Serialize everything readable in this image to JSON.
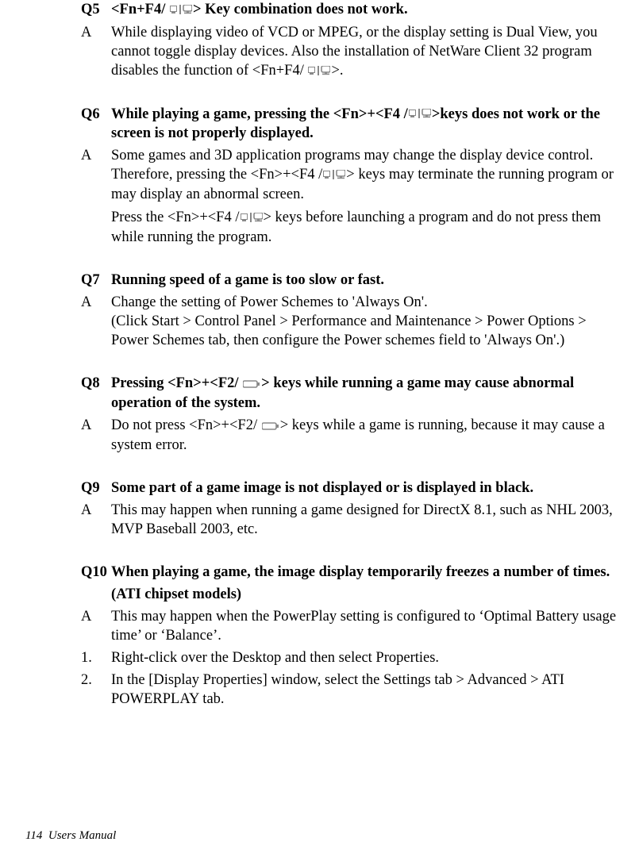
{
  "q5": {
    "label": "Q5",
    "question_a": "<Fn+F4/ ",
    "question_b": "> Key combination does not work.",
    "answer_label": "A",
    "answer_a": "While displaying video of VCD or MPEG, or the display setting is Dual View, you cannot toggle display devices. Also the installation of NetWare Client 32 program disables the function of <Fn+F4/ ",
    "answer_b": ">."
  },
  "q6": {
    "label": "Q6",
    "question_a": "While playing a game, pressing the <Fn>+<F4 /",
    "question_b": ">keys does not work or the screen is not properly displayed.",
    "answer_label": "A",
    "answer_a": "Some games and 3D application programs may change the display device control. Therefore, pressing the <Fn>+<F4 /",
    "answer_b": "> keys may terminate the running program or may display an abnormal screen.",
    "answer2_a": "Press the <Fn>+<F4 /",
    "answer2_b": "> keys before launching a program and do not press them while running the program."
  },
  "q7": {
    "label": "Q7",
    "question": "Running speed of a game is too slow or fast.",
    "answer_label": "A",
    "answer": "Change the setting of Power Schemes to 'Always On'.\n(Click Start > Control Panel > Performance and Maintenance > Power Options > Power Schemes tab, then configure the Power schemes field to 'Always On'.)"
  },
  "q8": {
    "label": "Q8",
    "question_a": "Pressing <Fn>+<F2/ ",
    "question_b": "> keys while running a game may cause abnormal operation of the system.",
    "answer_label": "A",
    "answer_a": "Do not press <Fn>+<F2/ ",
    "answer_b": "> keys while a game is running, because it may cause a system error."
  },
  "q9": {
    "label": "Q9",
    "question": "Some part of a game image is not displayed or is displayed in black.",
    "answer_label": "A",
    "answer": "This may happen when running a game designed for DirectX 8.1, such as NHL 2003, MVP Baseball 2003, etc."
  },
  "q10": {
    "label": "Q10",
    "question": "When playing a game, the image display temporarily freezes a number of times.",
    "subtitle": "(ATI chipset models)",
    "answer_label": "A",
    "answer": "This may happen when the PowerPlay setting is configured to ‘Optimal Battery usage time’ or ‘Balance’.",
    "step1_label": "1.",
    "step1": "Right-click over the Desktop and then select Properties.",
    "step2_label": "2.",
    "step2": "In the [Display Properties] window, select the Settings tab > Advanced > ATI POWERPLAY tab."
  },
  "footer": {
    "page": "114",
    "title": "Users Manual"
  }
}
